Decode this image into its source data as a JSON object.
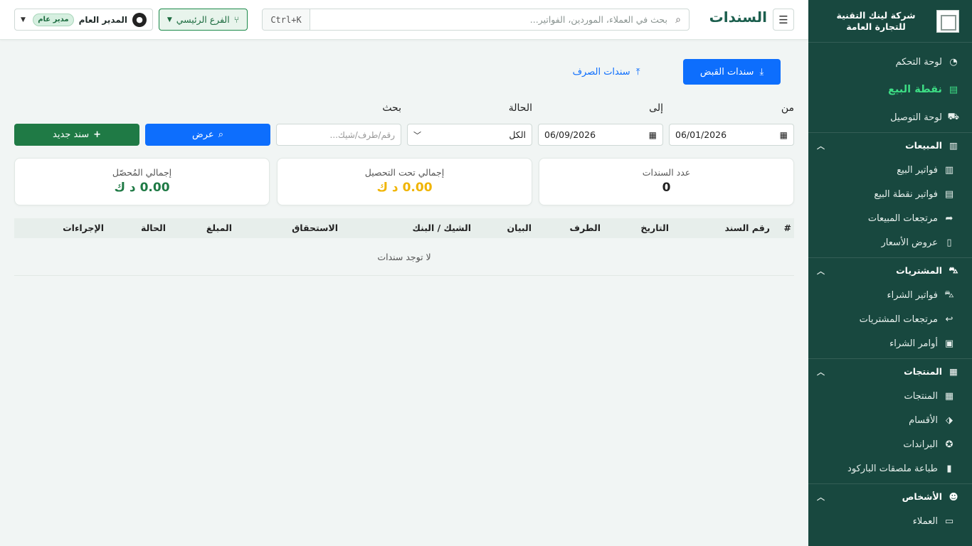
{
  "sidebar": {
    "company_name": "شركة لينك التقنية للتجارة العامة",
    "items": {
      "dashboard": {
        "label": "لوحة التحكم",
        "icon": "gauge-icon"
      },
      "pos": {
        "label": "نقطة البيع",
        "icon": "cash-register-icon"
      },
      "delivery": {
        "label": "لوحة التوصيل",
        "icon": "truck-icon"
      }
    },
    "sections": {
      "sales": {
        "label": "المبيعات",
        "items": [
          "فواتير البيع",
          "فواتير نقطة البيع",
          "مرتجعات المبيعات",
          "عروض الأسعار"
        ]
      },
      "purchases": {
        "label": "المشتريات",
        "items": [
          "فواتير الشراء",
          "مرتجعات المشتريات",
          "أوامر الشراء"
        ]
      },
      "products": {
        "label": "المنتجات",
        "items": [
          "المنتجات",
          "الأقسام",
          "البراندات",
          "طباعة ملصقات الباركود"
        ]
      },
      "people": {
        "label": "الأشخاص",
        "items": [
          "العملاء"
        ]
      }
    }
  },
  "topbar": {
    "title": "السندات",
    "search_placeholder": "بحث في العملاء، الموردين، الفواتير...",
    "shortcut": "Ctrl+K",
    "branch": "الفرع الرئيسي",
    "user_name": "المدير العام",
    "user_role": "مدير عام"
  },
  "tabs": {
    "receipts": "سندات القبض",
    "payments": "سندات الصرف"
  },
  "filters": {
    "from_label": "من",
    "from_value": "06/01/2026",
    "to_label": "إلى",
    "to_value": "06/09/2026",
    "status_label": "الحالة",
    "status_value": "الكل",
    "search_label": "بحث",
    "search_placeholder": "رقم/طرف/شيك...",
    "show_button": "عرض",
    "new_button": "سند جديد"
  },
  "cards": {
    "count": {
      "label": "عدد السندات",
      "value": "0"
    },
    "pending": {
      "label": "إجمالي تحت التحصيل",
      "value": "0.00 د ك",
      "color": "#f0b400"
    },
    "collected": {
      "label": "إجمالي المُحصّل",
      "value": "0.00 د ك",
      "color": "#1f7a45"
    }
  },
  "table": {
    "columns": [
      "#",
      "رقم السند",
      "التاريخ",
      "الطرف",
      "البيان",
      "الشيك / البنك",
      "الاستحقاق",
      "المبلغ",
      "الحالة",
      "الإجراءات"
    ],
    "empty_message": "لا توجد سندات"
  },
  "colors": {
    "sidebar_bg": "#18483f",
    "active_nav": "#3ddc84",
    "primary": "#0d6efd",
    "success": "#1f7a45"
  }
}
